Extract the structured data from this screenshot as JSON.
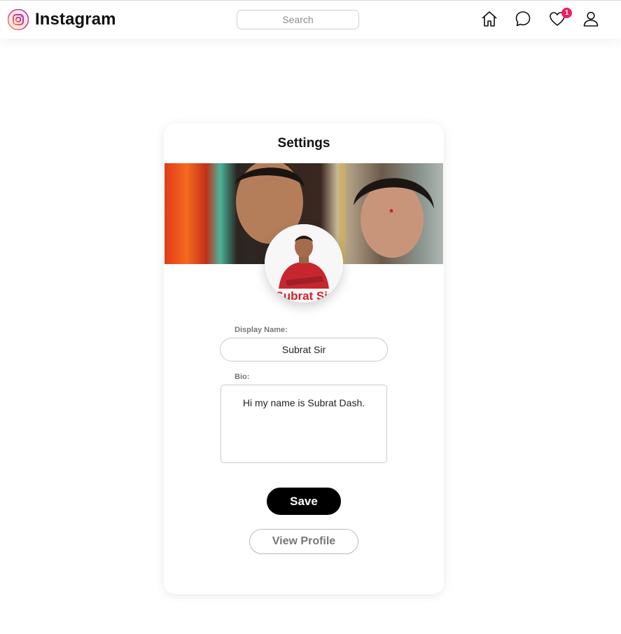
{
  "app": {
    "name": "Instagram"
  },
  "nav": {
    "search_placeholder": "Search",
    "icons": [
      "home-icon",
      "message-icon",
      "heart-icon",
      "profile-icon"
    ],
    "notification_count": "1",
    "badge_color": "#ed1d5f"
  },
  "settings": {
    "title": "Settings",
    "avatar_caption": "Subrat Sir",
    "display_name_label": "Display Name:",
    "display_name_value": "Subrat Sir",
    "bio_label": "Bio:",
    "bio_value": "Hi my name is Subrat Dash.",
    "save_label": "Save",
    "view_profile_label": "View Profile"
  }
}
